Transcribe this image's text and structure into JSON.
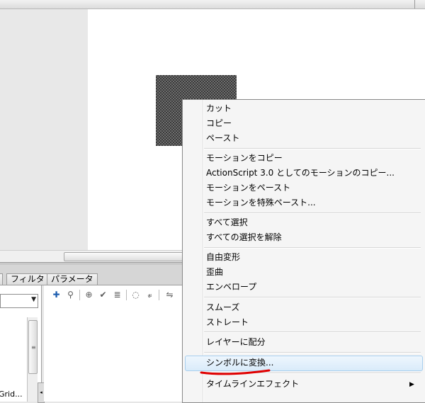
{
  "panel_tabs": [
    "フィルタ",
    "パラメータ"
  ],
  "left_pane": {
    "truncated_label": "Grid..."
  },
  "actions_toolbar": {
    "tools": [
      "add-icon",
      "find-icon",
      "target-icon",
      "check-syntax-icon",
      "format-icon",
      "code-hint-icon",
      "debug-icon",
      "collapse-icon"
    ]
  },
  "code_snippet_partial": "...",
  "context_menu": {
    "groups": [
      [
        "カット",
        "コピー",
        "ペースト"
      ],
      [
        "モーションをコピー",
        "ActionScript 3.0 としてのモーションのコピー...",
        "モーションをペースト",
        "モーションを特殊ペースト..."
      ],
      [
        "すべて選択",
        "すべての選択を解除"
      ],
      [
        "自由変形",
        "歪曲",
        "エンベロープ"
      ],
      [
        "スムーズ",
        "ストレート"
      ],
      [
        "レイヤーに配分"
      ],
      [
        "シンボルに変換..."
      ],
      [
        "タイムラインエフェクト"
      ]
    ],
    "highlighted_item": "シンボルに変換...",
    "submenu_item": "タイムラインエフェクト",
    "highlight_color": "#d9ebfa",
    "annotation_color": "#e00000"
  }
}
